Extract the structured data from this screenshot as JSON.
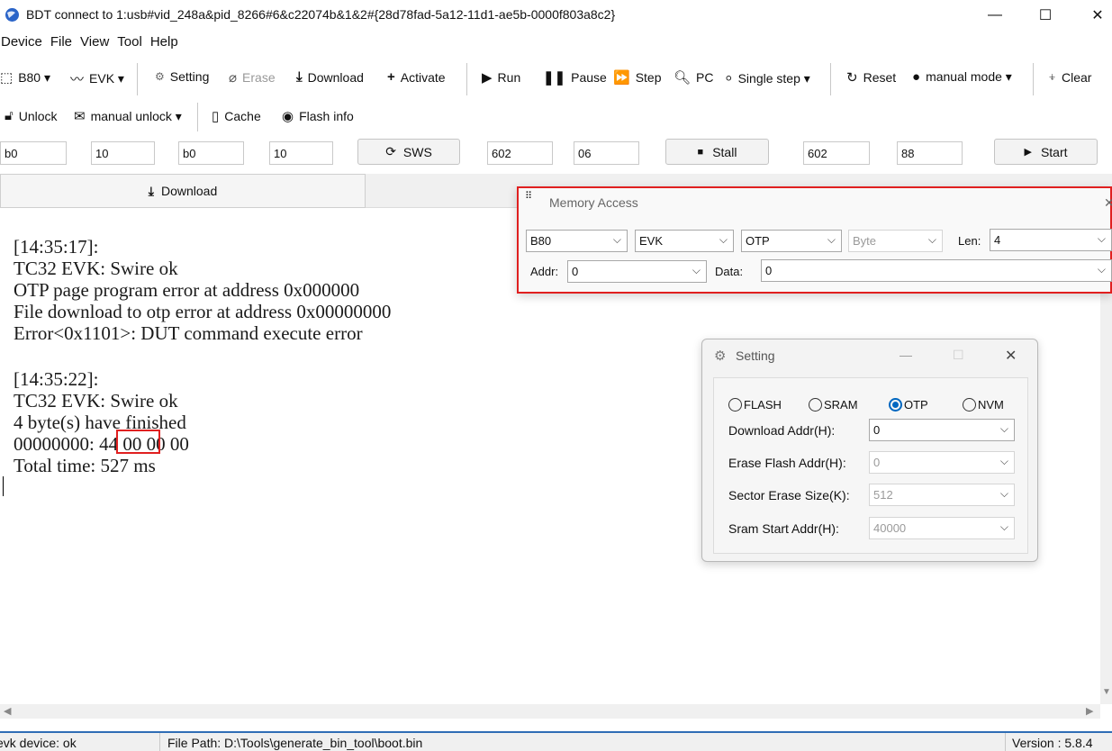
{
  "window": {
    "title": "BDT connect to 1:usb#vid_248a&pid_8266#6&c22074b&1&2#{28d78fad-5a12-11d1-ae5b-0000f803a8c2}",
    "minimize": "—",
    "maximize": "☐",
    "close": "✕"
  },
  "menu": [
    "Device",
    "File",
    "View",
    "Tool",
    "Help"
  ],
  "toolbar1": {
    "chip": "B80 ▾",
    "board": "EVK ▾",
    "setting": "Setting",
    "erase": "Erase",
    "download": "Download",
    "activate": "Activate",
    "run": "Run",
    "pause": "Pause",
    "step": "Step",
    "pc": "PC",
    "single_step": "Single step ▾",
    "reset": "Reset",
    "manual_mode": "manual mode ▾",
    "clear": "Clear"
  },
  "toolbar2": {
    "unlock": "Unlock",
    "manual_unlock": "manual unlock ▾",
    "cache": "Cache",
    "flash_info": "Flash info"
  },
  "row3": {
    "f1": "b0",
    "f2": "10",
    "f3": "b0",
    "f4": "10",
    "sws": "SWS",
    "f5": "602",
    "f6": "06",
    "stall": "Stall",
    "f7": "602",
    "f8": "88",
    "start": "Start"
  },
  "tabs": {
    "download": "Download"
  },
  "log": {
    "block1": "[14:35:17]:\nTC32 EVK: Swire ok\nOTP page program error at address 0x000000\nFile download to otp error at address 0x00000000\nError<0x1101>: DUT command execute error",
    "block2": "[14:35:22]:\nTC32 EVK: Swire ok\n4 byte(s) have finished\n00000000: 44 00 00 00\nTotal time: 527 ms"
  },
  "memory_access": {
    "title": "Memory Access",
    "chip": "B80",
    "board": "EVK",
    "memory": "OTP",
    "unit": "Byte",
    "len_label": "Len:",
    "len_value": "4",
    "addr_label": "Addr:",
    "addr_value": "0",
    "data_label": "Data:",
    "data_value": "0"
  },
  "setting_dialog": {
    "title": "Setting",
    "radios": [
      "FLASH",
      "SRAM",
      "OTP",
      "NVM"
    ],
    "selected": "OTP",
    "download_addr_label": "Download  Addr(H):",
    "download_addr_value": "0",
    "erase_flash_label": "Erase Flash Addr(H):",
    "erase_flash_value": "0",
    "sector_erase_label": "Sector Erase Size(K):",
    "sector_erase_value": "512",
    "sram_start_label": "Sram Start Addr(H):",
    "sram_start_value": "40000"
  },
  "status": {
    "device": "evk device: ok",
    "file_path": "File Path:  D:\\Tools\\generate_bin_tool\\boot.bin",
    "version": "Version : 5.8.4"
  },
  "colors": {
    "highlight": "#e02020",
    "accent": "#0067c0",
    "status_line": "#2f6db5"
  }
}
